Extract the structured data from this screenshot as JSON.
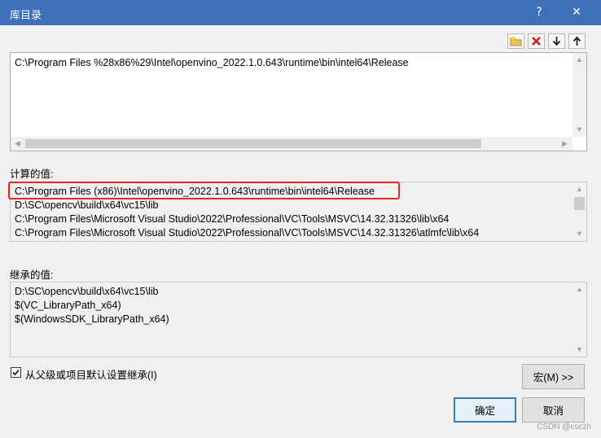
{
  "window": {
    "title": "库目录",
    "help_label": "?",
    "close_label": "✕"
  },
  "toolbar": {
    "icons": [
      "new-folder-icon",
      "delete-icon",
      "move-down-icon",
      "move-up-icon"
    ]
  },
  "editor": {
    "lines": [
      "C:\\Program Files %28x86%29\\Intel\\openvino_2022.1.0.643\\runtime\\bin\\intel64\\Release"
    ]
  },
  "evaluated": {
    "label": "计算的值:",
    "lines": [
      "C:\\Program Files (x86)\\Intel\\openvino_2022.1.0.643\\runtime\\bin\\intel64\\Release",
      "D:\\SC\\opencv\\build\\x64\\vc15\\lib",
      "C:\\Program Files\\Microsoft Visual Studio\\2022\\Professional\\VC\\Tools\\MSVC\\14.32.31326\\lib\\x64",
      "C:\\Program Files\\Microsoft Visual Studio\\2022\\Professional\\VC\\Tools\\MSVC\\14.32.31326\\atlmfc\\lib\\x64"
    ]
  },
  "inherited": {
    "label": "继承的值:",
    "lines": [
      "D:\\SC\\opencv\\build\\x64\\vc15\\lib",
      "$(VC_LibraryPath_x64)",
      "$(WindowsSDK_LibraryPath_x64)"
    ]
  },
  "inherit_checkbox": {
    "label": "从父级或项目默认设置继承(I)",
    "checked": true
  },
  "buttons": {
    "macros": "宏(M) >>",
    "ok": "确定",
    "cancel": "取消"
  },
  "watermark": "CSDN @csczh"
}
